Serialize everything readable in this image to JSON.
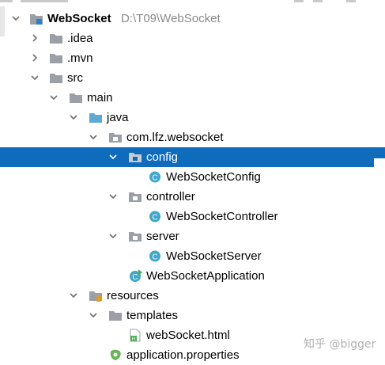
{
  "project": {
    "name": "WebSocket",
    "path": "D:\\T09\\WebSocket"
  },
  "tree": {
    "idea": ".idea",
    "mvn": ".mvn",
    "src": "src",
    "main": "main",
    "java": "java",
    "package": "com.lfz.websocket",
    "config": "config",
    "config_class": "WebSocketConfig",
    "controller": "controller",
    "controller_class": "WebSocketController",
    "server": "server",
    "server_class": "WebSocketServer",
    "app_class": "WebSocketApplication",
    "resources": "resources",
    "templates": "templates",
    "html_file": "webSocket.html",
    "properties_file": "application.properties"
  },
  "selected_item": "config",
  "watermark": "知乎 @bigger",
  "colors": {
    "selection": "#0f6cbd",
    "folder_gray": "#9aa0a6",
    "folder_blue": "#5fa8d3",
    "class_icon": "#3fa7c9"
  }
}
